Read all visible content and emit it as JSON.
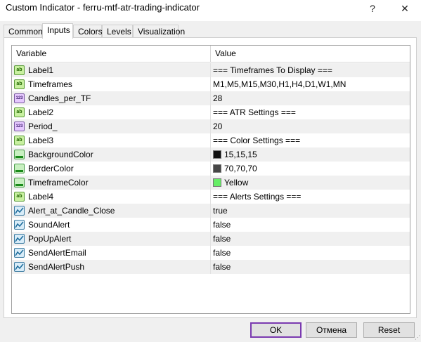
{
  "window": {
    "title": "Custom Indicator - ferru-mtf-atr-trading-indicator",
    "help_glyph": "?",
    "close_glyph": "✕"
  },
  "tabs": [
    "Common",
    "Inputs",
    "Colors",
    "Levels",
    "Visualization"
  ],
  "active_tab": "Inputs",
  "grid": {
    "header": {
      "variable": "Variable",
      "value": "Value"
    },
    "rows": [
      {
        "type": "ab",
        "icon": "string-icon",
        "name": "Label1",
        "value": "=== Timeframes To Display ==="
      },
      {
        "type": "ab",
        "icon": "string-icon",
        "name": "Timeframes",
        "value": "M1,M5,M15,M30,H1,H4,D1,W1,MN"
      },
      {
        "type": "num",
        "icon": "integer-icon",
        "name": "Candles_per_TF",
        "value": "28"
      },
      {
        "type": "ab",
        "icon": "string-icon",
        "name": "Label2",
        "value": "=== ATR Settings ==="
      },
      {
        "type": "num",
        "icon": "integer-icon",
        "name": "Period_",
        "value": "20"
      },
      {
        "type": "ab",
        "icon": "string-icon",
        "name": "Label3",
        "value": "=== Color Settings ==="
      },
      {
        "type": "color",
        "icon": "color-icon",
        "name": "BackgroundColor",
        "value": "15,15,15",
        "swatch": "#0f0f0f"
      },
      {
        "type": "color",
        "icon": "color-icon",
        "name": "BorderColor",
        "value": "70,70,70",
        "swatch": "#464646"
      },
      {
        "type": "color",
        "icon": "color-icon",
        "name": "TimeframeColor",
        "value": "Yellow",
        "swatch": "#66ee66"
      },
      {
        "type": "ab",
        "icon": "string-icon",
        "name": "Label4",
        "value": "=== Alerts Settings ==="
      },
      {
        "type": "bool",
        "icon": "bool-icon",
        "name": "Alert_at_Candle_Close",
        "value": "true"
      },
      {
        "type": "bool",
        "icon": "bool-icon",
        "name": "SoundAlert",
        "value": "false"
      },
      {
        "type": "bool",
        "icon": "bool-icon",
        "name": "PopUpAlert",
        "value": "false"
      },
      {
        "type": "bool",
        "icon": "bool-icon",
        "name": "SendAlertEmail",
        "value": "false"
      },
      {
        "type": "bool",
        "icon": "bool-icon",
        "name": "SendAlertPush",
        "value": "false"
      }
    ]
  },
  "buttons": {
    "ok": "OK",
    "cancel": "Отмена",
    "reset": "Reset"
  },
  "icons": {
    "ab_label": "ab",
    "num_label": "123"
  }
}
